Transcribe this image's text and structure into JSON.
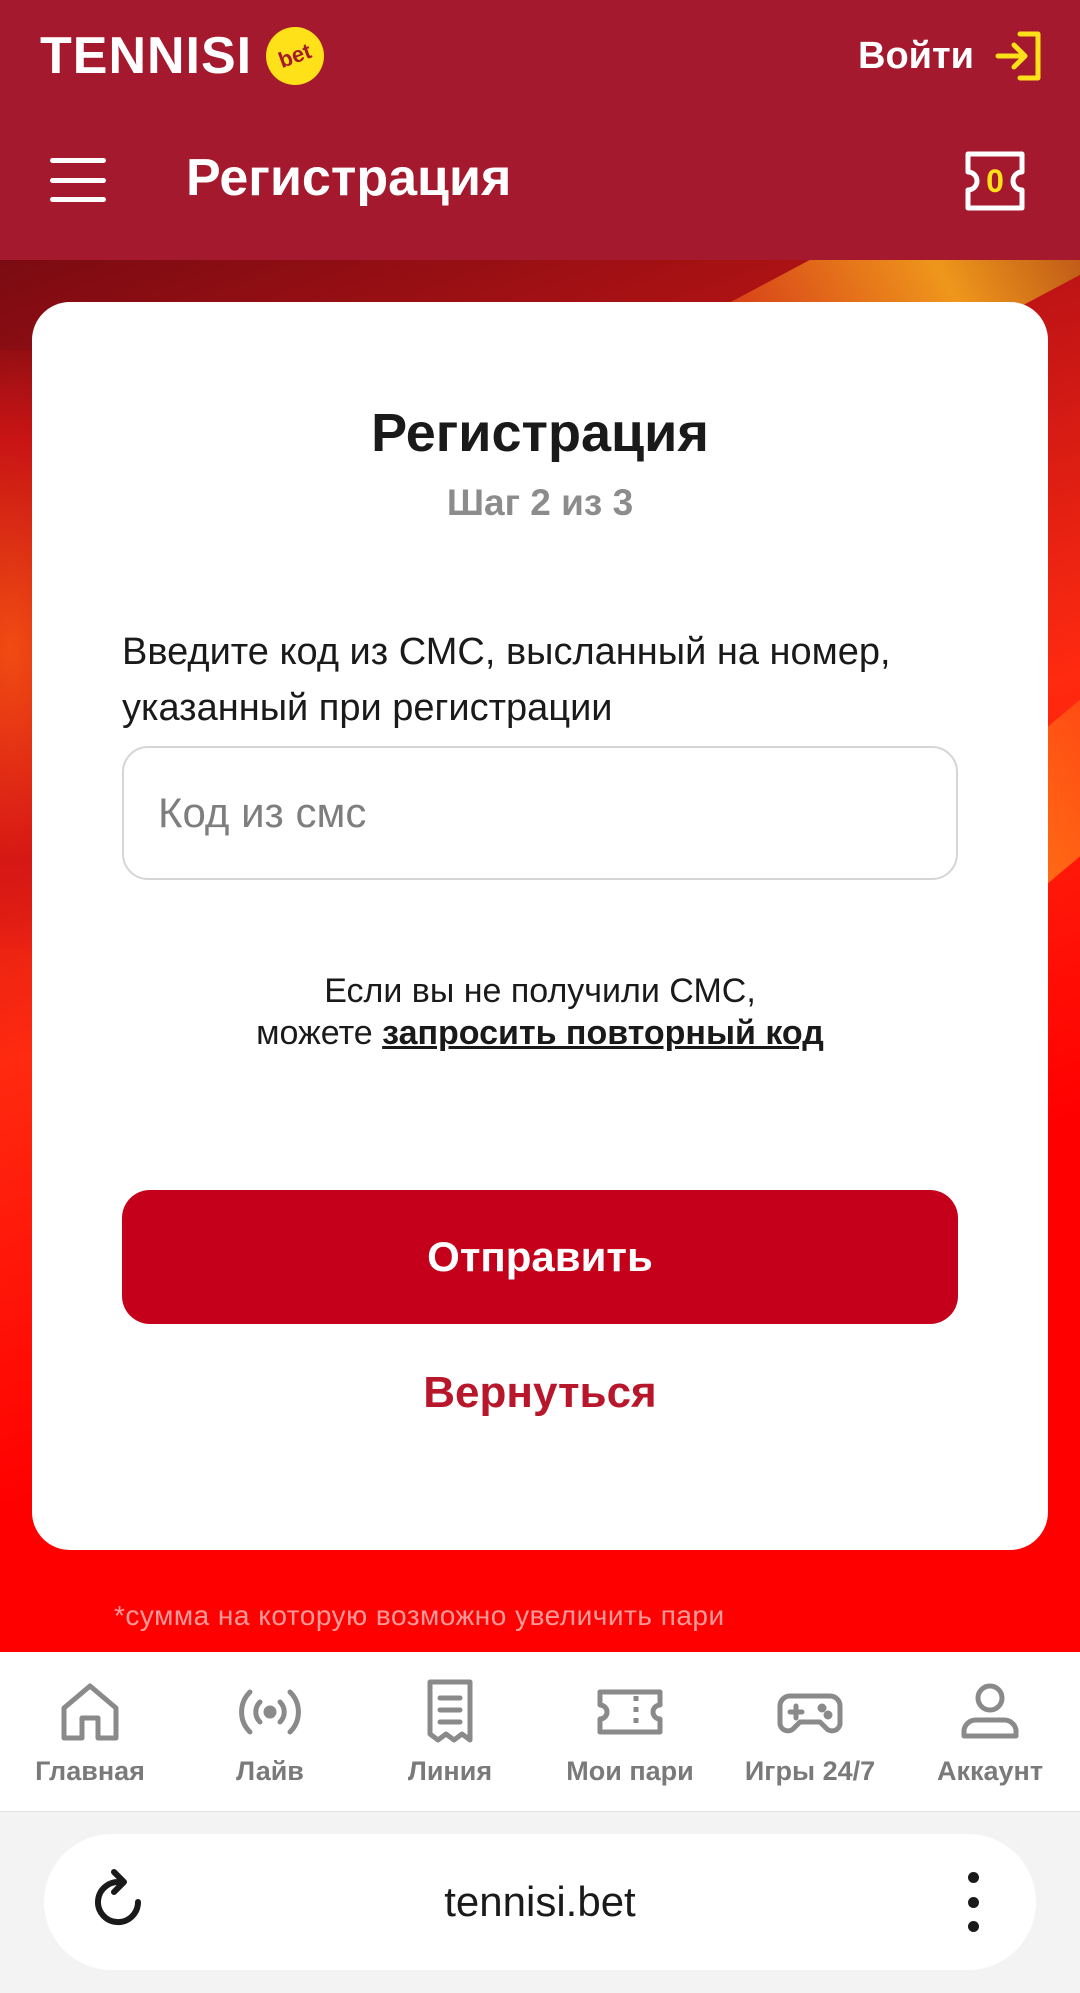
{
  "header": {
    "logo_text": "TENNISI",
    "logo_badge": "bet",
    "login_label": "Войти",
    "page_title": "Регистрация",
    "coupon_count": "0"
  },
  "card": {
    "title": "Регистрация",
    "step": "Шаг 2 из 3",
    "instruction": "Введите код из СМС, высланный на номер, указанный при регистрации",
    "input": {
      "placeholder": "Код из смс",
      "value": ""
    },
    "resend_prefix_line1": "Если вы не получили СМС,",
    "resend_prefix_line2": "можете",
    "resend_link": "запросить повторный код",
    "submit_label": "Отправить",
    "back_label": "Вернуться"
  },
  "footnote": "*сумма на которую возможно увеличить пари",
  "bottom_nav": {
    "items": [
      {
        "label": "Главная",
        "icon": "home-icon"
      },
      {
        "label": "Лайв",
        "icon": "broadcast-icon"
      },
      {
        "label": "Линия",
        "icon": "receipt-icon"
      },
      {
        "label": "Мои пари",
        "icon": "ticket-icon"
      },
      {
        "label": "Игры 24/7",
        "icon": "gamepad-icon"
      },
      {
        "label": "Аккаунт",
        "icon": "user-icon"
      }
    ]
  },
  "browser": {
    "url": "tennisi.bet"
  },
  "colors": {
    "brand": "#a5192f",
    "accent_yellow": "#ffe11a",
    "submit": "#c4001b",
    "link_red": "#b8172b"
  }
}
